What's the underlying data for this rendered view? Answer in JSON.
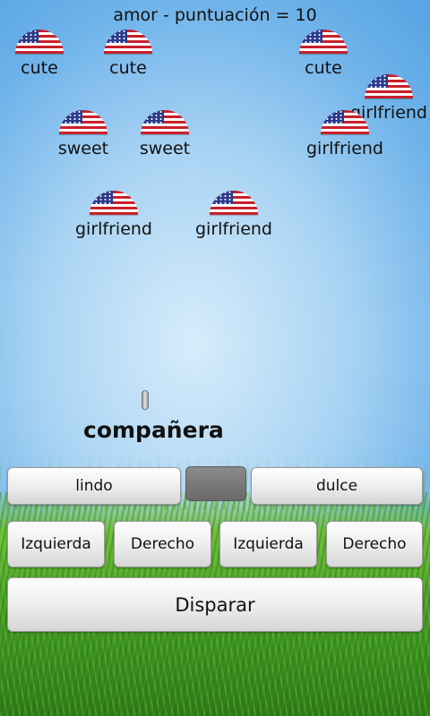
{
  "score_text": "amor - puntuación = 10",
  "enemies": [
    {
      "word": "cute"
    },
    {
      "word": "cute"
    },
    {
      "word": "cute"
    },
    {
      "word": "girlfriend"
    },
    {
      "word": "sweet"
    },
    {
      "word": "sweet"
    },
    {
      "word": "girlfriend"
    },
    {
      "word": "girlfriend"
    },
    {
      "word": "girlfriend"
    }
  ],
  "target_word": "compañera",
  "options": {
    "left": "lindo",
    "middle": "",
    "right": "dulce"
  },
  "controls": {
    "left1": "Izquierda",
    "right1": "Derecho",
    "left2": "Izquierda",
    "right2": "Derecho"
  },
  "fire_label": "Disparar",
  "colors": {
    "flag_red": "#c8202a",
    "flag_blue": "#2a3a8c",
    "sky": "#a9d3f3",
    "grass": "#4ea52a"
  }
}
